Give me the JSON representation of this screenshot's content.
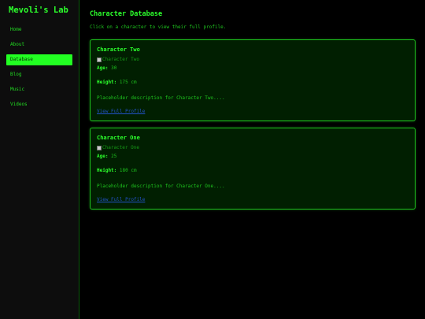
{
  "sidebar": {
    "title": "Mevoli's Lab",
    "items": [
      {
        "label": "Home"
      },
      {
        "label": "About"
      },
      {
        "label": "Database"
      },
      {
        "label": "Blog"
      },
      {
        "label": "Music"
      },
      {
        "label": "Videos"
      }
    ],
    "active_item": "Database"
  },
  "main": {
    "title": "Character Database",
    "intro": "Click on a character to view their full profile.",
    "characters": [
      {
        "name": "Character Two",
        "image_alt": "Character Two",
        "age_label": "Age:",
        "age": "30",
        "height_label": "Height:",
        "height": "175 cm",
        "description": "Placeholder description for Character Two....",
        "link": "View Full Profile"
      },
      {
        "name": "Character One",
        "image_alt": "Character One",
        "age_label": "Age:",
        "age": "25",
        "height_label": "Height:",
        "height": "180 cm",
        "description": "Placeholder description for Character One....",
        "link": "View Full Profile"
      }
    ]
  },
  "colors": {
    "background": "#000000",
    "sidebar_bg": "#0d0d0d",
    "accent_green": "#2cff2c",
    "active_nav_bg": "#22ff22",
    "card_bg": "#011f01",
    "link": "#2252c8"
  }
}
